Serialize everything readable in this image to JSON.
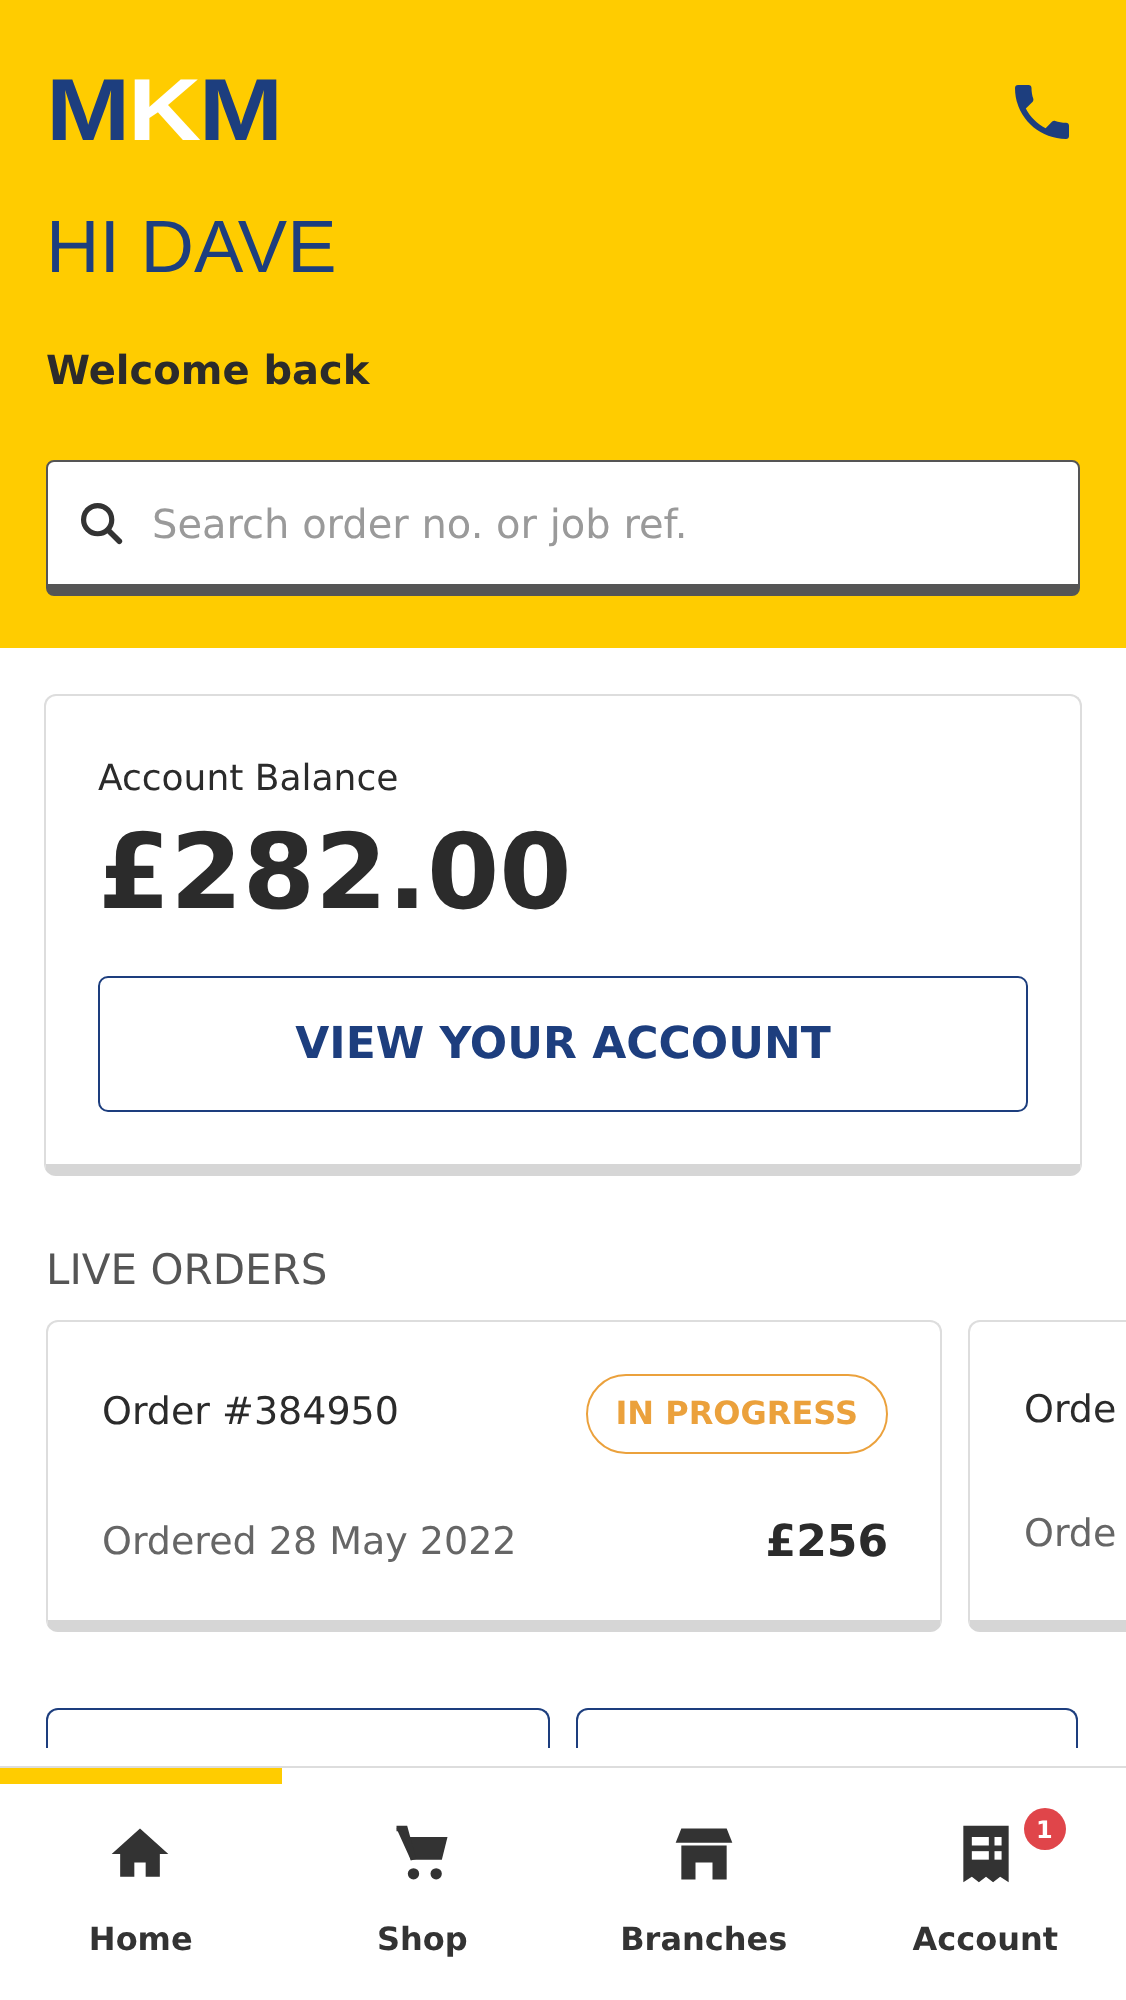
{
  "header": {
    "logo": "MKM",
    "greeting": "HI DAVE",
    "subtitle": "Welcome back",
    "search": {
      "placeholder": "Search order no. or job ref."
    }
  },
  "balance": {
    "label": "Account Balance",
    "amount": "£282.00",
    "button": "VIEW YOUR ACCOUNT"
  },
  "live_orders": {
    "title": "LIVE ORDERS",
    "orders": [
      {
        "number": "Order #384950",
        "status": "IN PROGRESS",
        "date": "Ordered 28 May 2022",
        "total": "£256"
      },
      {
        "number": "Orde",
        "date": "Orde"
      }
    ]
  },
  "tab_bar": [
    {
      "label": "Home",
      "selected": true
    },
    {
      "label": "Shop",
      "selected": false
    },
    {
      "label": "Branches",
      "selected": false
    },
    {
      "label": "Account",
      "selected": false,
      "badge": "1"
    }
  ]
}
